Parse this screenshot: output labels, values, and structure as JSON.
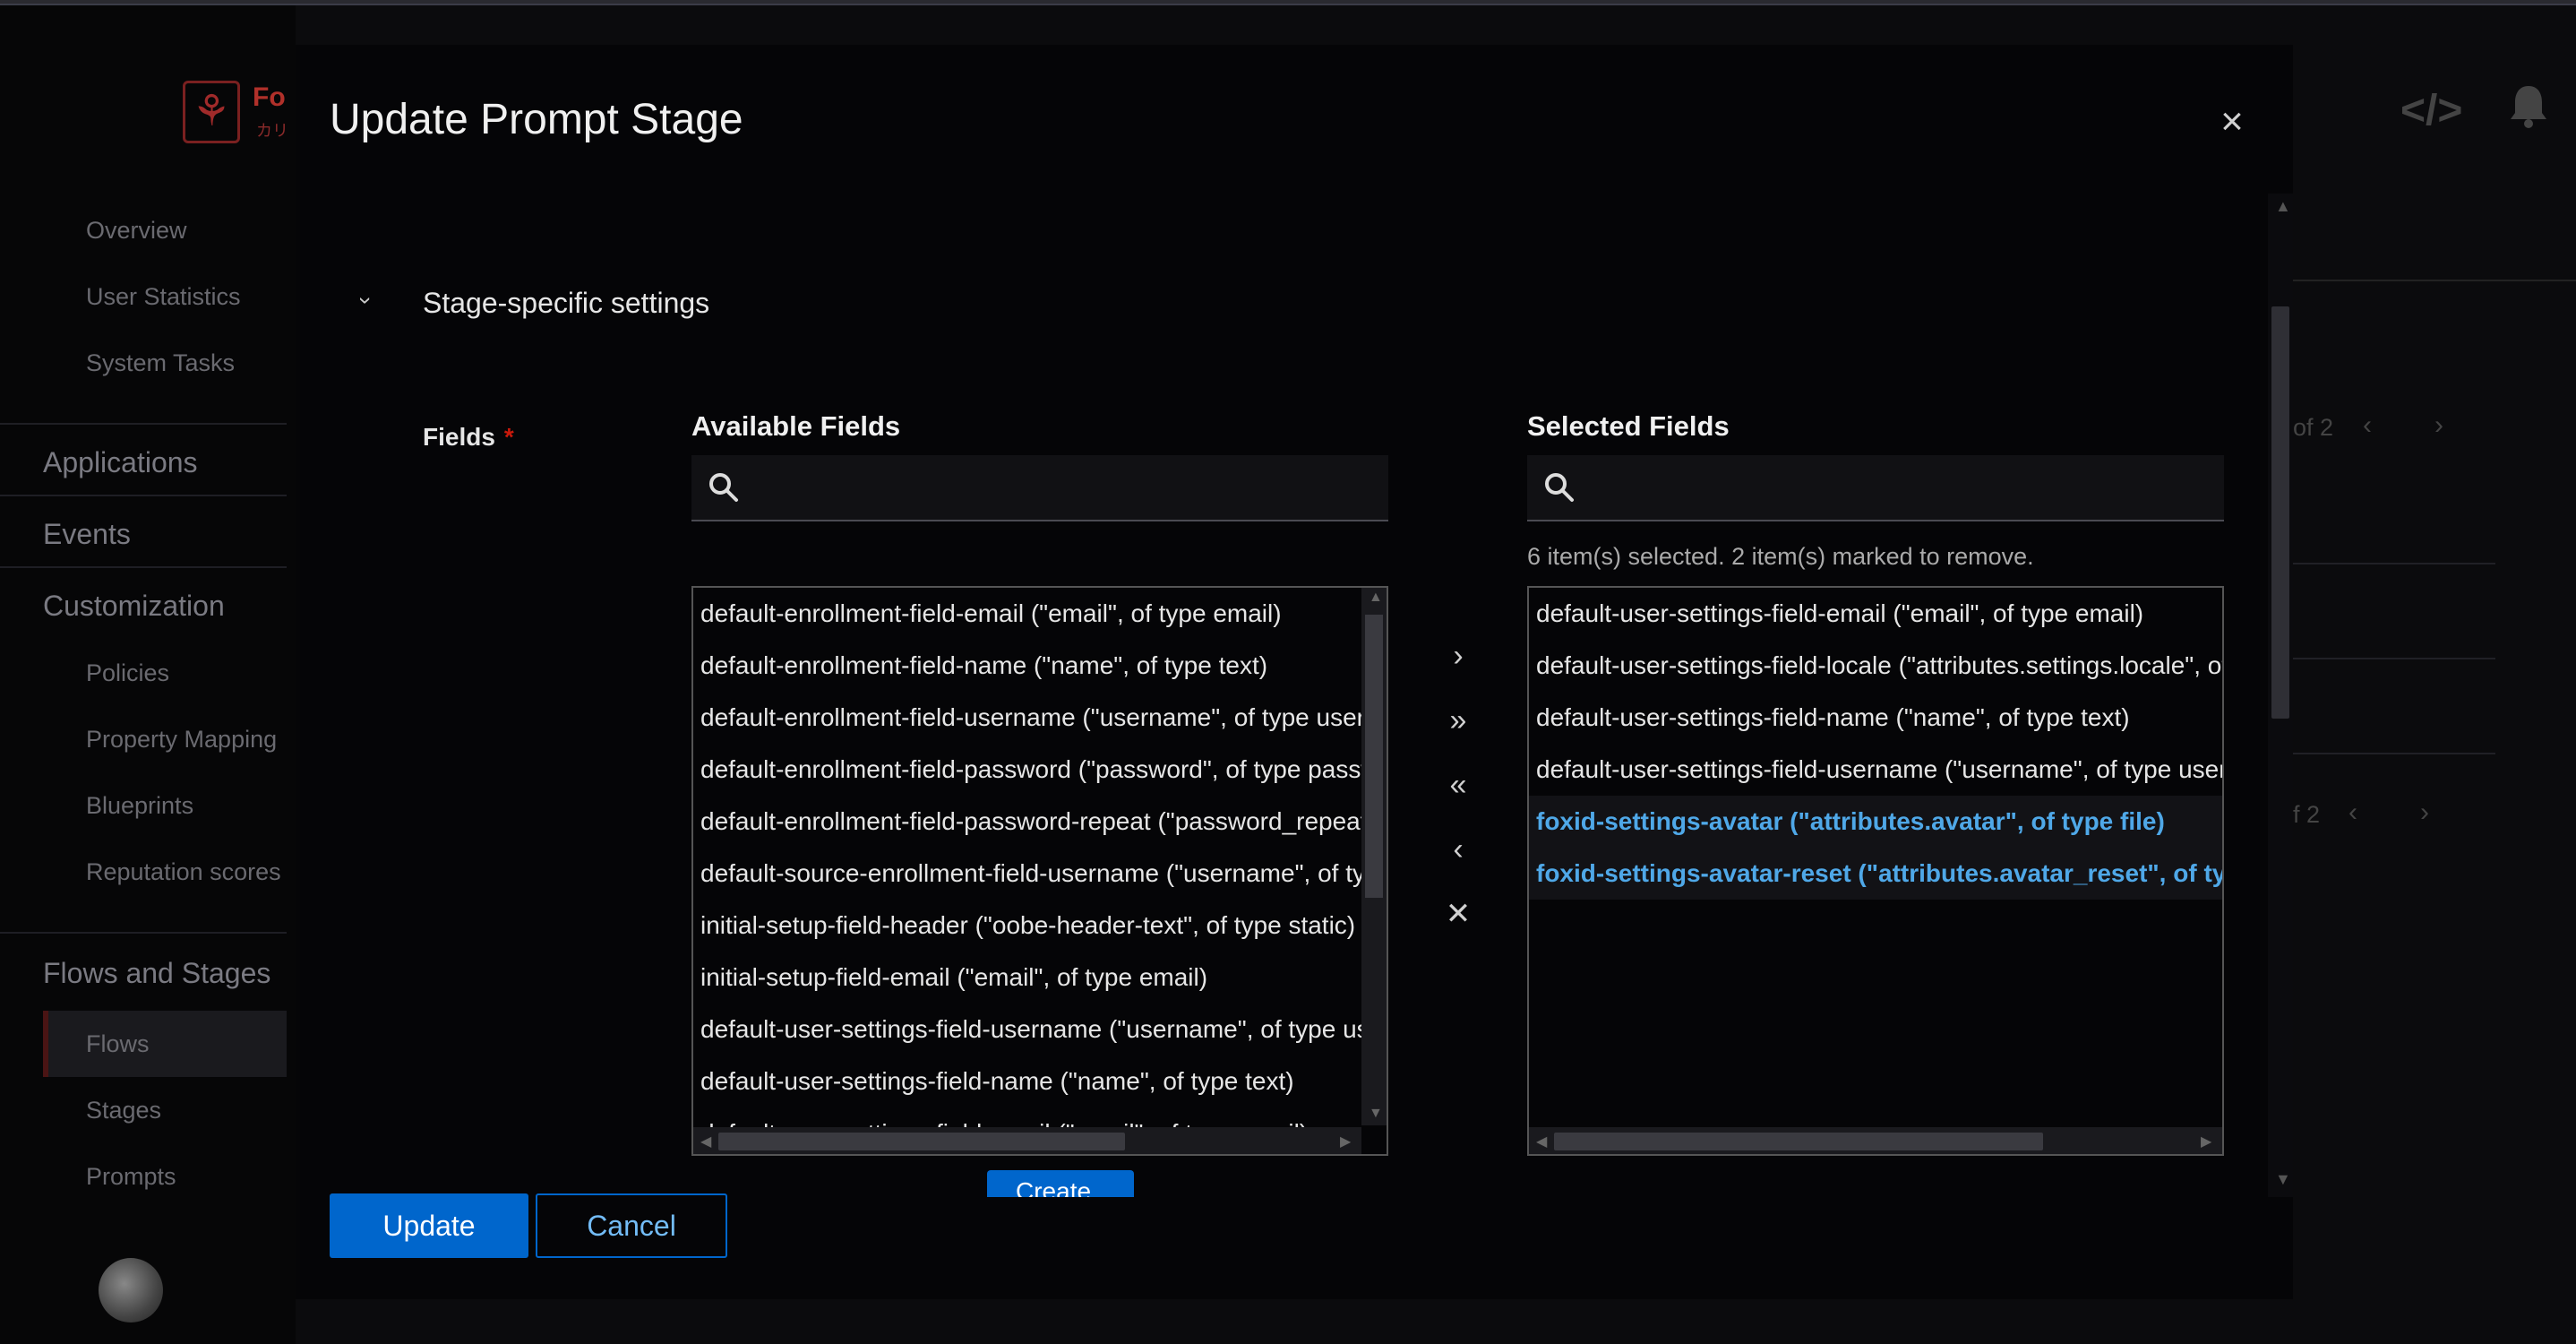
{
  "brand": {
    "logo_text": "Fo",
    "logo_sub": "カリ"
  },
  "sidebar": {
    "top_items": [
      "Overview",
      "User Statistics",
      "System Tasks"
    ],
    "applications": "Applications",
    "events": "Events",
    "customization": "Customization",
    "customization_items": [
      "Policies",
      "Property Mapping",
      "Blueprints",
      "Reputation scores"
    ],
    "flows_and_stages": "Flows and Stages",
    "flows_items": [
      "Flows",
      "Stages",
      "Prompts"
    ]
  },
  "background": {
    "pagination_1": "of 2",
    "pagination_2": "f 2"
  },
  "modal": {
    "title": "Update Prompt Stage",
    "section_title": "Stage-specific settings",
    "fields_label": "Fields",
    "required_mark": "*",
    "available": {
      "title": "Available Fields",
      "search_placeholder": "",
      "items": [
        "default-enrollment-field-email (\"email\", of type email)",
        "default-enrollment-field-name (\"name\", of type text)",
        "default-enrollment-field-username (\"username\", of type username)",
        "default-enrollment-field-password (\"password\", of type password)",
        "default-enrollment-field-password-repeat (\"password_repeat\", of type password)",
        "default-source-enrollment-field-username (\"username\", of type username)",
        "initial-setup-field-header (\"oobe-header-text\", of type static)",
        "initial-setup-field-email (\"email\", of type email)",
        "default-user-settings-field-username (\"username\", of type username)",
        "default-user-settings-field-name (\"name\", of type text)",
        "default-user-settings-field-email (\"email\", of type email)"
      ]
    },
    "selected": {
      "title": "Selected Fields",
      "search_placeholder": "",
      "status": "6 item(s) selected. 2 item(s) marked to remove.",
      "items": [
        "default-user-settings-field-email (\"email\", of type email)",
        "default-user-settings-field-locale (\"attributes.settings.locale\", of type ak-locale)",
        "default-user-settings-field-name (\"name\", of type text)",
        "default-user-settings-field-username (\"username\", of type username)",
        "foxid-settings-avatar (\"attributes.avatar\", of type file)",
        "foxid-settings-avatar-reset (\"attributes.avatar_reset\", of type checkbox)"
      ]
    },
    "controls": {
      "add": "›",
      "add_all": "»",
      "remove_all": "«",
      "remove": "‹",
      "clear": "✕"
    },
    "create_label": "Create",
    "update_label": "Update",
    "cancel_label": "Cancel",
    "close_glyph": "×"
  }
}
